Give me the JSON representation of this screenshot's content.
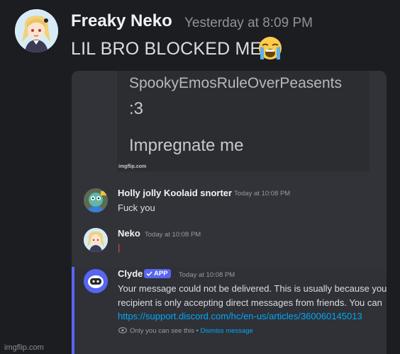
{
  "post": {
    "author": "Freaky Neko",
    "timestamp": "Yesterday at 8:09 PM",
    "message": "LIL BRO BLOCKED ME",
    "emoji": "loudly-crying-face"
  },
  "meme": {
    "line1": "SpookyEmosRuleOverPeasents",
    "line2": ":3",
    "line3": "Impregnate me",
    "watermark": "imgflip.com"
  },
  "chat": {
    "messages": [
      {
        "author": "Holly jolly Koolaid snorter",
        "time": "Today at 10:08 PM",
        "text": "Fuck you"
      },
      {
        "author": "Neko",
        "time": "Today at 10:08 PM",
        "text": "|"
      }
    ],
    "clyde": {
      "author": "Clyde",
      "badge": "APP",
      "time": "Today at 10:08 PM",
      "line1": "Your message could not be delivered. This is usually because you",
      "line2": "recipient is only accepting direct messages from friends. You can",
      "link": "https://support.discord.com/hc/en-us/articles/360060145013",
      "note": "Only you can see this",
      "sep": "•",
      "dismiss": "Dismiss message"
    }
  },
  "footer_watermark": "imgflip.com",
  "colors": {
    "background": "#1c1d21",
    "card": "#313338",
    "accent": "#5865f2",
    "link": "#00a8fc"
  }
}
